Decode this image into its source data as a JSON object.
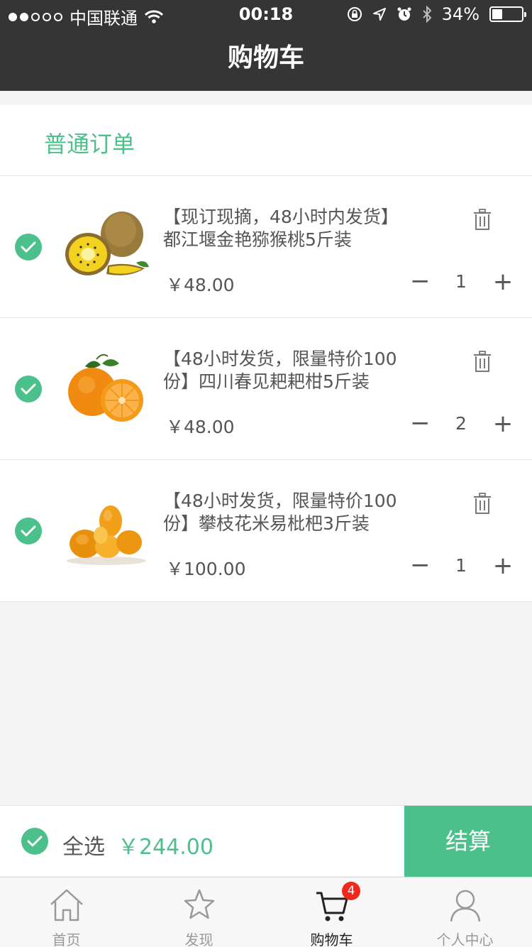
{
  "status_bar": {
    "carrier": "中国联通",
    "time": "00:18",
    "battery": "34%",
    "battery_level": 0.34
  },
  "nav": {
    "title": "购物车"
  },
  "section": {
    "title": "普通订单"
  },
  "items": [
    {
      "title": "【现订现摘，48小时内发货】都江堰金艳猕猴桃5斤装",
      "price": "￥48.00",
      "quantity": "1",
      "selected": true,
      "image": "kiwi"
    },
    {
      "title": "【48小时发货，限量特价100份】四川春见耙耙柑5斤装",
      "price": "￥48.00",
      "quantity": "2",
      "selected": true,
      "image": "orange"
    },
    {
      "title": "【48小时发货，限量特价100份】攀枝花米易枇杷3斤装",
      "price": "￥100.00",
      "quantity": "1",
      "selected": true,
      "image": "loquat"
    }
  ],
  "qty_controls": {
    "minus": "−",
    "plus": "+"
  },
  "checkout": {
    "select_all_label": "全选",
    "total": "￥244.00",
    "button_label": "结算"
  },
  "tabs": [
    {
      "label": "首页",
      "icon": "home-icon",
      "active": false
    },
    {
      "label": "发现",
      "icon": "star-icon",
      "active": false
    },
    {
      "label": "购物车",
      "icon": "cart-icon",
      "active": true,
      "badge": "4"
    },
    {
      "label": "个人中心",
      "icon": "user-icon",
      "active": false
    }
  ],
  "colors": {
    "accent": "#4cc08a",
    "header_bg": "#353535",
    "badge": "#f2281c",
    "page_bg": "#f4f4f4"
  }
}
